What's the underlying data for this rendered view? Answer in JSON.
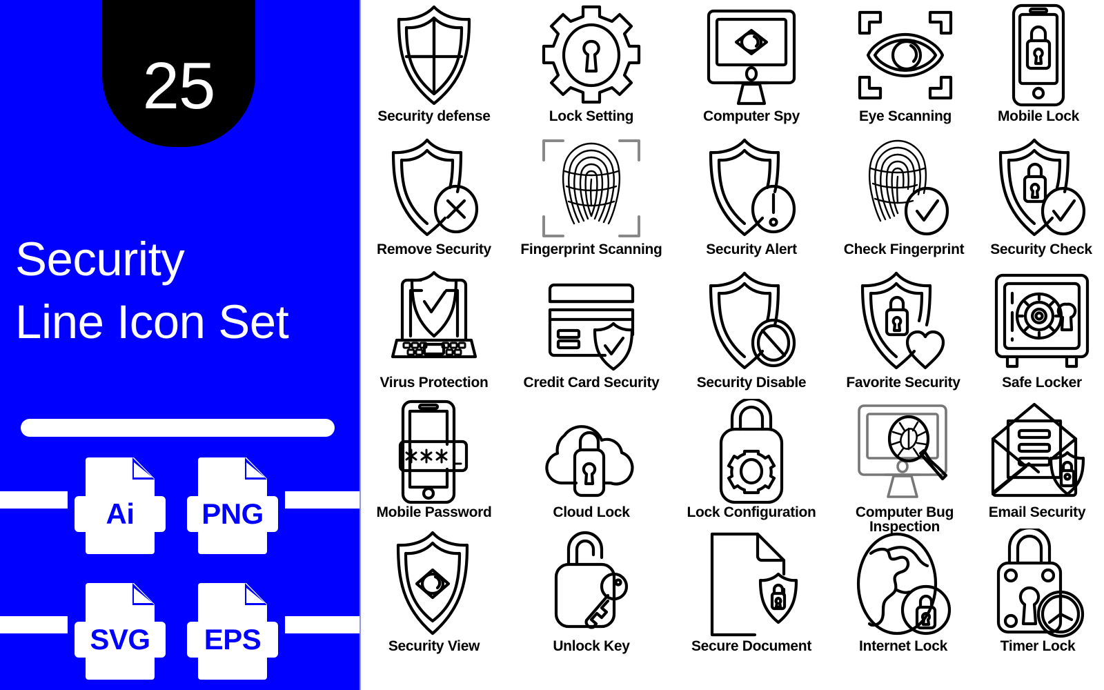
{
  "cover": {
    "count": "25",
    "title_line1": "Security",
    "title_line2": "Line Icon Set",
    "accent_color": "#0000FF",
    "badge_color": "#000000",
    "text_color": "#FFFFFF",
    "formats": [
      {
        "name": "Ai",
        "icon": "file-ai-icon"
      },
      {
        "name": "PNG",
        "icon": "file-png-icon"
      },
      {
        "name": "SVG",
        "icon": "file-svg-icon"
      },
      {
        "name": "EPS",
        "icon": "file-eps-icon"
      }
    ]
  },
  "grid": {
    "columns": 5,
    "rows": 5,
    "stroke_color": "#000000",
    "icons": [
      {
        "label": "Security defense",
        "icon": "shield-quarters-icon"
      },
      {
        "label": "Lock Setting",
        "icon": "gear-keyhole-icon"
      },
      {
        "label": "Computer Spy",
        "icon": "monitor-eye-icon"
      },
      {
        "label": "Eye Scanning",
        "icon": "eye-scan-frame-icon"
      },
      {
        "label": "Mobile Lock",
        "icon": "phone-padlock-icon"
      },
      {
        "label": "Remove Security",
        "icon": "shield-cross-icon"
      },
      {
        "label": "Fingerprint Scanning",
        "icon": "fingerprint-scan-frame-icon"
      },
      {
        "label": "Security Alert",
        "icon": "shield-exclamation-icon"
      },
      {
        "label": "Check Fingerprint",
        "icon": "fingerprint-check-icon"
      },
      {
        "label": "Security Check",
        "icon": "shield-lock-check-icon"
      },
      {
        "label": "Virus Protection",
        "icon": "laptop-shield-check-icon"
      },
      {
        "label": "Credit Card Security",
        "icon": "credit-card-shield-icon"
      },
      {
        "label": "Security Disable",
        "icon": "shield-no-entry-icon"
      },
      {
        "label": "Favorite Security",
        "icon": "shield-lock-heart-icon"
      },
      {
        "label": "Safe Locker",
        "icon": "safe-vault-icon"
      },
      {
        "label": "Mobile Password",
        "icon": "phone-password-icon"
      },
      {
        "label": "Cloud Lock",
        "icon": "cloud-padlock-icon"
      },
      {
        "label": "Lock Configuration",
        "icon": "padlock-gear-icon"
      },
      {
        "label": "Computer Bug\nInspection",
        "icon": "monitor-bug-magnifier-icon"
      },
      {
        "label": "Email Security",
        "icon": "envelope-shield-lock-icon"
      },
      {
        "label": "Security View",
        "icon": "shield-eye-icon"
      },
      {
        "label": "Unlock Key",
        "icon": "open-padlock-key-icon"
      },
      {
        "label": "Secure Document",
        "icon": "document-shield-lock-icon"
      },
      {
        "label": "Internet Lock",
        "icon": "globe-padlock-icon"
      },
      {
        "label": "Timer Lock",
        "icon": "padlock-clock-icon"
      }
    ]
  }
}
